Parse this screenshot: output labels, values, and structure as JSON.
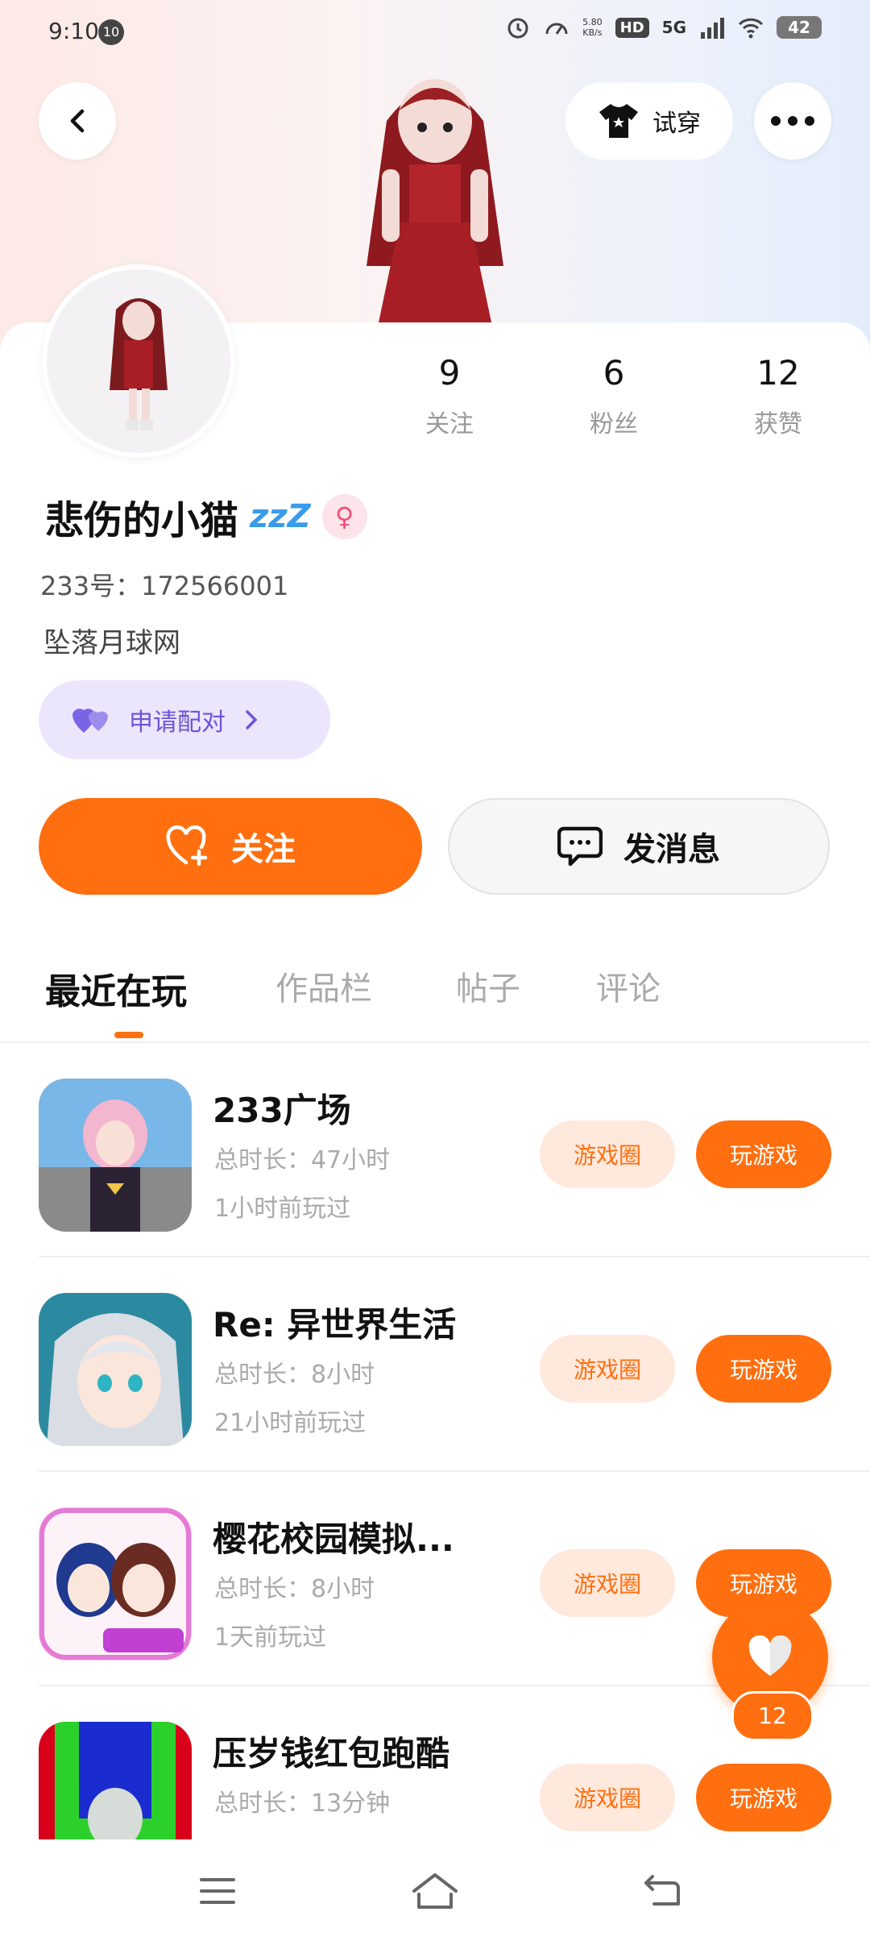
{
  "status_bar": {
    "time": "9:10",
    "notification_count": "10",
    "net_speed": "5.80",
    "net_speed_unit": "KB/s",
    "hd": "HD",
    "network": "5G",
    "battery": "42"
  },
  "header": {
    "try_on_label": "试穿"
  },
  "profile": {
    "stats": [
      {
        "value": "9",
        "label": "关注"
      },
      {
        "value": "6",
        "label": "粉丝"
      },
      {
        "value": "12",
        "label": "获赞"
      }
    ],
    "username": "悲伤的小猫",
    "status_emoji": "zzZ",
    "gender_symbol": "♀",
    "uid": "233号：172566001",
    "bio": "坠落月球网",
    "pair_label": "申请配对",
    "follow_label": "关注",
    "message_label": "发消息"
  },
  "tabs": [
    {
      "label": "最近在玩",
      "active": true
    },
    {
      "label": "作品栏",
      "active": false
    },
    {
      "label": "帖子",
      "active": false
    },
    {
      "label": "评论",
      "active": false
    }
  ],
  "games": [
    {
      "title": "233广场",
      "duration": "总时长：47小时",
      "last_played": "1小时前玩过",
      "circle_label": "游戏圈",
      "play_label": "玩游戏"
    },
    {
      "title": "Re: 异世界生活",
      "duration": "总时长：8小时",
      "last_played": "21小时前玩过",
      "circle_label": "游戏圈",
      "play_label": "玩游戏"
    },
    {
      "title": "樱花校园模拟...",
      "duration": "总时长：8小时",
      "last_played": "1天前玩过",
      "circle_label": "游戏圈",
      "play_label": "玩游戏"
    },
    {
      "title": "压岁钱红包跑酷",
      "duration": "总时长：13分钟",
      "last_played": "",
      "circle_label": "游戏圈",
      "play_label": "玩游戏"
    }
  ],
  "like_float": {
    "count": "12"
  },
  "colors": {
    "accent": "#ff6f0f",
    "accent_light": "#ffe8dc",
    "pair_purple": "#6b55d8"
  }
}
